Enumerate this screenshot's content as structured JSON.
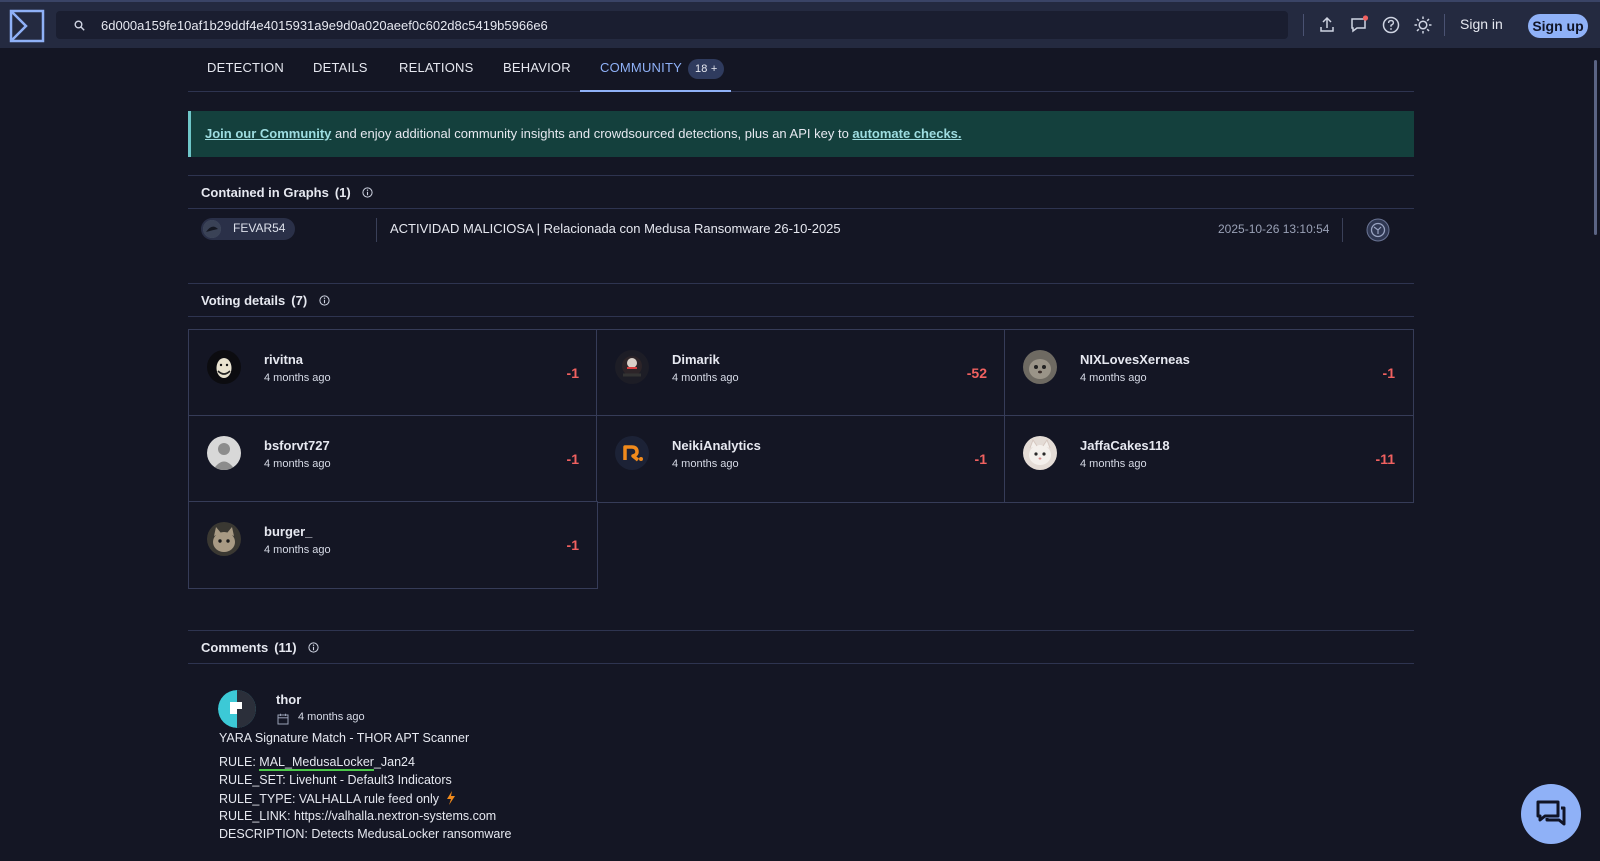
{
  "search": {
    "value": "6d000a159fe10af1b29ddf4e4015931a9e9d0a020aeef0c602d8c5419b5966e6"
  },
  "header": {
    "sign_in": "Sign in",
    "sign_up": "Sign up"
  },
  "tabs": [
    {
      "label": "DETECTION"
    },
    {
      "label": "DETAILS"
    },
    {
      "label": "RELATIONS"
    },
    {
      "label": "BEHAVIOR"
    },
    {
      "label": "COMMUNITY",
      "badge": "18 +"
    }
  ],
  "banner": {
    "link1": "Join our Community",
    "text": " and enjoy additional community insights and crowdsourced detections, plus an API key to ",
    "link2": "automate checks."
  },
  "graphs": {
    "title": "Contained in Graphs",
    "count": "(1)",
    "row": {
      "user": "FEVAR54",
      "name": "ACTIVIDAD MALICIOSA | Relacionada con Medusa Ransomware 26-10-2025",
      "date": "2025-10-26 13:10:54"
    }
  },
  "voting": {
    "title": "Voting details",
    "count": "(7)",
    "votes": [
      {
        "name": "rivitna",
        "time": "4 months ago",
        "score": "-1"
      },
      {
        "name": "Dimarik",
        "time": "4 months ago",
        "score": "-52"
      },
      {
        "name": "NIXLovesXerneas",
        "time": "4 months ago",
        "score": "-1"
      },
      {
        "name": "bsforvt727",
        "time": "4 months ago",
        "score": "-1"
      },
      {
        "name": "NeikiAnalytics",
        "time": "4 months ago",
        "score": "-1"
      },
      {
        "name": "JaffaCakes118",
        "time": "4 months ago",
        "score": "-11"
      },
      {
        "name": "burger_",
        "time": "4 months ago",
        "score": "-1"
      }
    ]
  },
  "comments": {
    "title": "Comments",
    "count": "(11)",
    "first": {
      "user": "thor",
      "time": "4 months ago",
      "headline": "YARA Signature Match - THOR APT Scanner",
      "rule_prefix": "RULE: ",
      "rule_value": "MAL_MedusaLocker",
      "rule_suffix": "_Jan24",
      "rule_set": "RULE_SET: Livehunt - Default3 Indicators",
      "rule_type": "RULE_TYPE: VALHALLA rule feed only",
      "rule_link": "RULE_LINK: https://valhalla.nextron-systems.com",
      "description": "DESCRIPTION: Detects MedusaLocker ransomware"
    }
  },
  "colors": {
    "background": "#141624",
    "topbar": "#242a40",
    "accent": "#8fb1f7",
    "negative_score": "#f16160",
    "banner_bg": "#14403d"
  },
  "icons": [
    "logo-icon",
    "search-icon",
    "upload-icon",
    "chat-icon",
    "help-icon",
    "theme-icon",
    "info-icon",
    "graph-icon",
    "calendar-icon",
    "bolt-icon",
    "chat-bubbles-icon"
  ]
}
